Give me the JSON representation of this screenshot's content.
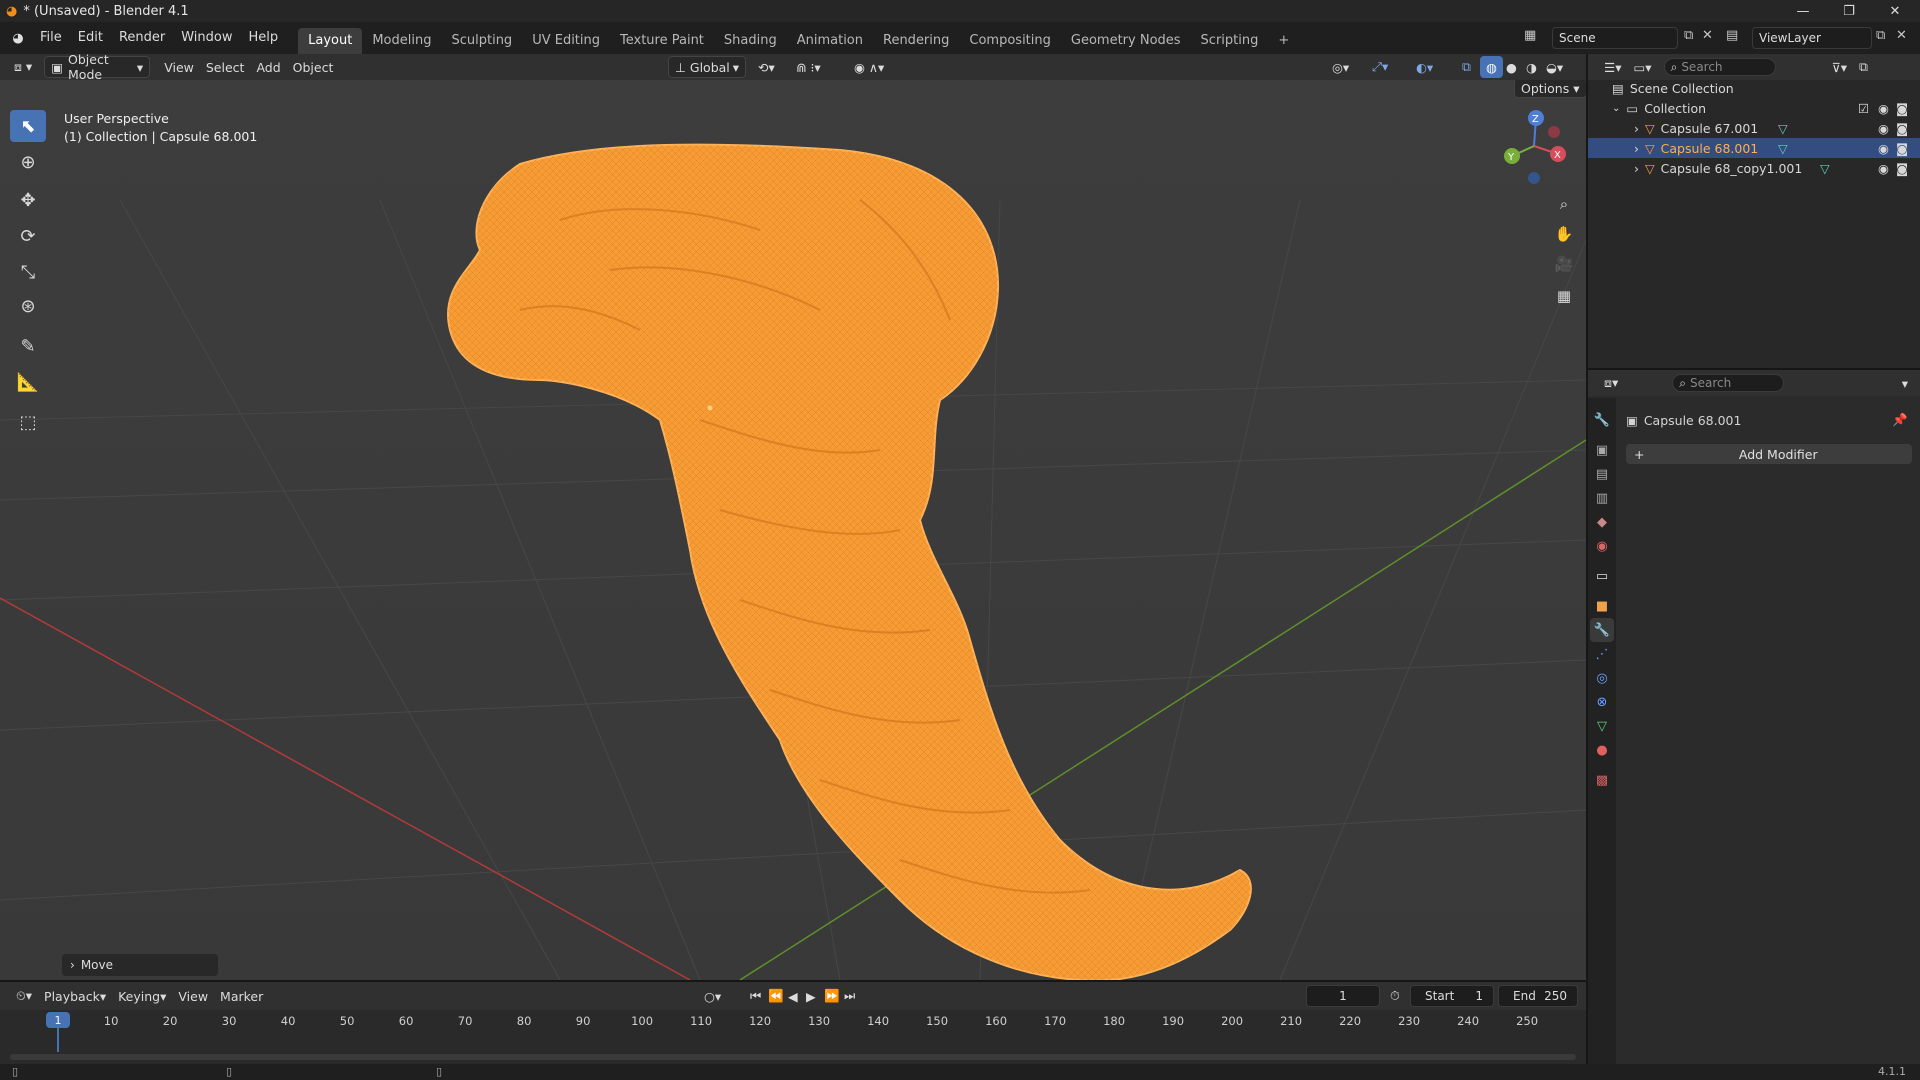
{
  "window": {
    "title": "* (Unsaved) - Blender 4.1"
  },
  "menu": {
    "items": [
      "File",
      "Edit",
      "Render",
      "Window",
      "Help"
    ]
  },
  "workspaces": {
    "tabs": [
      "Layout",
      "Modeling",
      "Sculpting",
      "UV Editing",
      "Texture Paint",
      "Shading",
      "Animation",
      "Rendering",
      "Compositing",
      "Geometry Nodes",
      "Scripting"
    ],
    "add": "+"
  },
  "scene": {
    "label": "Scene"
  },
  "viewlayer": {
    "label": "ViewLayer"
  },
  "viewport_header": {
    "mode": "Object Mode",
    "menus": [
      "View",
      "Select",
      "Add",
      "Object"
    ],
    "transform_orientation": "Global",
    "options": "Options"
  },
  "viewport": {
    "perspective": "User Perspective",
    "info": "(1) Collection | Capsule 68.001",
    "last_operator": "Move"
  },
  "gizmo": {
    "z": "Z",
    "x": "X",
    "y": "Y"
  },
  "outliner": {
    "search_placeholder": "Search",
    "scene_collection": "Scene Collection",
    "collection": "Collection",
    "objects": [
      "Capsule 67.001",
      "Capsule 68.001",
      "Capsule 68_copy1.001"
    ],
    "selected_index": 1
  },
  "properties": {
    "search_placeholder": "Search",
    "object_name": "Capsule 68.001",
    "add_modifier": "Add Modifier"
  },
  "timeline": {
    "menus": [
      "Playback",
      "Keying",
      "View",
      "Marker"
    ],
    "current_frame": "1",
    "start_label": "Start",
    "start": "1",
    "end_label": "End",
    "end": "250",
    "ticks": [
      "1",
      "10",
      "20",
      "30",
      "40",
      "50",
      "60",
      "70",
      "80",
      "90",
      "100",
      "110",
      "120",
      "130",
      "140",
      "150",
      "160",
      "170",
      "180",
      "190",
      "200",
      "210",
      "220",
      "230",
      "240",
      "250"
    ]
  },
  "statusbar": {
    "version": "4.1.1"
  },
  "colors": {
    "accent": "#4772b3",
    "selection": "#ffa033",
    "x_axis": "#b33a3a",
    "y_axis": "#5f8f2a"
  }
}
